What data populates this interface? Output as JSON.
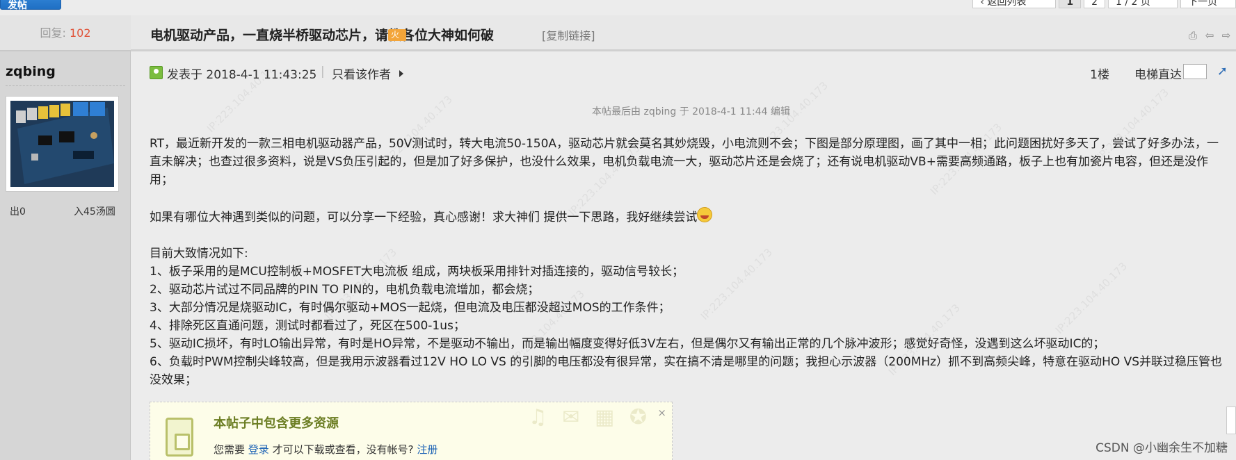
{
  "topbar": {
    "post_button": "发帖",
    "back_to_list": "‹ 返回列表",
    "pages": [
      "1",
      "2"
    ],
    "page_jump": "1 / 2 页",
    "next_page": "下一页"
  },
  "left": {
    "reply_label": "回复:",
    "reply_count": "102",
    "username": "zqbing",
    "stat_out": "出0",
    "stat_in": "入45汤圆"
  },
  "thread": {
    "title": "电机驱动产品，一直烧半桥驱动芯片，请教各位大神如何破",
    "copy_link": "[复制链接]"
  },
  "post": {
    "posted_at": "发表于 2018-4-1 11:43:25",
    "author_only": "只看该作者",
    "floor": "1楼",
    "elevator": "电梯直达",
    "edit_note": "本帖最后由 zqbing 于 2018-4-1 11:44 编辑",
    "para1": "RT，最近新开发的一款三相电机驱动器产品，50V测试时，转大电流50-150A，驱动芯片就会莫名其妙烧毁，小电流则不会；下图是部分原理图，画了其中一相；此问题困扰好多天了，尝试了好多办法，一直未解决；也查过很多资料，说是VS负压引起的，但是加了好多保护，也没什么效果，电机负载电流一大，驱动芯片还是会烧了；还有说电机驱动VB+需要高频通路，板子上也有加瓷片电容，但还是没作用；",
    "para2": "如果有哪位大神遇到类似的问题，可以分享一下经验，真心感谢！求大神们 提供一下思路，我好继续尝试",
    "intro": "目前大致情况如下:",
    "items": [
      "1、板子采用的是MCU控制板+MOSFET大电流板 组成，两块板采用排针对插连接的，驱动信号较长；",
      "2、驱动芯片试过不同品牌的PIN TO PIN的，电机负载电流增加，都会烧；",
      "3、大部分情况是烧驱动IC，有时偶尔驱动+MOS一起烧，但电流及电压都没超过MOS的工作条件；",
      "4、排除死区直通问题，测试时都看过了，死区在500-1us；",
      "5、驱动IC损坏，有时LO输出异常，有时是HO异常，不是驱动不输出，而是输出幅度变得好低3V左右，但是偶尔又有输出正常的几个脉冲波形；感觉好奇怪，没遇到这么坏驱动IC的；",
      "6、负载时PWM控制尖峰较高，但是我用示波器看过12V  HO  LO  VS 的引脚的电压都没有很异常，实在搞不清是哪里的问题；我担心示波器（200MHz）抓不到高频尖峰，特意在驱动HO VS并联过稳压管也没效果；"
    ]
  },
  "resource": {
    "title": "本帖子中包含更多资源",
    "prefix": "您需要",
    "login": "登录",
    "middle": "才可以下载或查看，没有帐号?",
    "register": "注册",
    "close": "×"
  },
  "watermark_text": "IP:223.104.40.173",
  "csdn_mark": "CSDN @小幽余生不加糖",
  "colors": {
    "reply_number": "#e0543a",
    "link": "#1e64b5",
    "resource_title": "#6b7d22"
  }
}
